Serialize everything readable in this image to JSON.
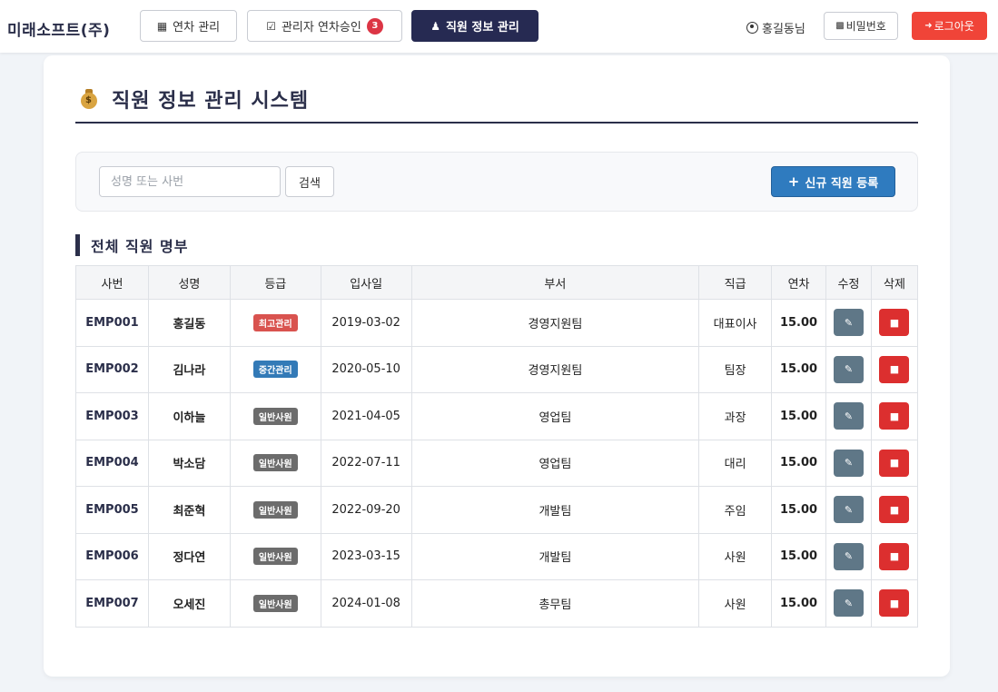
{
  "brand": "미래소프트(주)",
  "nav": {
    "leave_mgmt": "연차 관리",
    "approval": "관리자 연차승인",
    "approval_count": "3",
    "employee_mgmt": "직원 정보 관리"
  },
  "user": {
    "greeting": "홍길동님",
    "password_label": "비밀번호",
    "logout_label": "로그아웃"
  },
  "page": {
    "title": "직원 정보 관리 시스템",
    "section_title": "전체 직원 명부"
  },
  "search": {
    "placeholder": "성명 또는 사번",
    "button": "검색"
  },
  "new_employee_button": "신규 직원 등록",
  "table": {
    "headers": [
      "사번",
      "성명",
      "등급",
      "입사일",
      "부서",
      "직급",
      "연차",
      "수정",
      "삭제"
    ],
    "rows": [
      {
        "id": "EMP001",
        "name": "홍길동",
        "grade": "최고관리",
        "grade_color": "#d9534f",
        "hire_date": "2019-03-02",
        "dept": "경영지원팀",
        "position": "대표이사",
        "leave": "15.00"
      },
      {
        "id": "EMP002",
        "name": "김나라",
        "grade": "중간관리",
        "grade_color": "#337ab7",
        "hire_date": "2020-05-10",
        "dept": "경영지원팀",
        "position": "팀장",
        "leave": "15.00"
      },
      {
        "id": "EMP003",
        "name": "이하늘",
        "grade": "일반사원",
        "grade_color": "#6c6c6c",
        "hire_date": "2021-04-05",
        "dept": "영업팀",
        "position": "과장",
        "leave": "15.00"
      },
      {
        "id": "EMP004",
        "name": "박소담",
        "grade": "일반사원",
        "grade_color": "#6c6c6c",
        "hire_date": "2022-07-11",
        "dept": "영업팀",
        "position": "대리",
        "leave": "15.00"
      },
      {
        "id": "EMP005",
        "name": "최준혁",
        "grade": "일반사원",
        "grade_color": "#6c6c6c",
        "hire_date": "2022-09-20",
        "dept": "개발팀",
        "position": "주임",
        "leave": "15.00"
      },
      {
        "id": "EMP006",
        "name": "정다연",
        "grade": "일반사원",
        "grade_color": "#6c6c6c",
        "hire_date": "2023-03-15",
        "dept": "개발팀",
        "position": "사원",
        "leave": "15.00"
      },
      {
        "id": "EMP007",
        "name": "오세진",
        "grade": "일반사원",
        "grade_color": "#6c6c6c",
        "hire_date": "2024-01-08",
        "dept": "총무팀",
        "position": "사원",
        "leave": "15.00"
      }
    ]
  }
}
